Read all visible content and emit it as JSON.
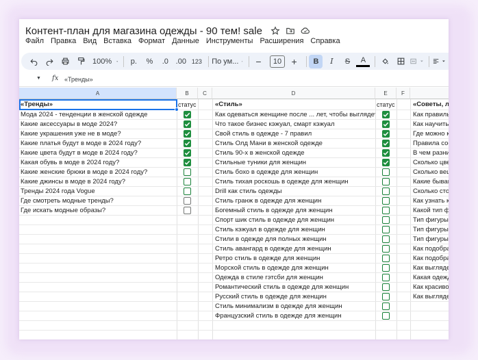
{
  "title": "Контент-план для магазина одежды - 90 тем! sale",
  "title_icons": [
    "star-icon",
    "move-to-folder-icon",
    "cloud-status-icon"
  ],
  "menu": [
    "Файл",
    "Правка",
    "Вид",
    "Вставка",
    "Формат",
    "Данные",
    "Инструменты",
    "Расширения",
    "Справка"
  ],
  "toolbar": {
    "zoom": "100%",
    "currency": "р.",
    "percent": "%",
    "dec_less": ".0",
    "dec_more": ".00",
    "num_format": "123",
    "font": "По ум...",
    "font_size": "10",
    "minus": "−",
    "plus": "+",
    "bold": "B",
    "italic": "I",
    "strike": "S",
    "text_color": "A",
    "icons": [
      "undo-icon",
      "redo-icon",
      "print-icon",
      "paint-format-icon",
      "chevron-down-icon",
      "fill-color-icon",
      "borders-icon",
      "merge-icon",
      "align-icon"
    ]
  },
  "formula_bar": {
    "fx": "fx",
    "value": "«Тренды»"
  },
  "columns": [
    "A",
    "B",
    "C",
    "D",
    "E",
    "F"
  ],
  "sheet": {
    "header": {
      "a": "«Тренды»",
      "b": "статус",
      "d": "«Стиль»",
      "e": "статус",
      "g": "«Советы, л"
    },
    "col_a": [
      "Мода 2024 - тенденции в женской одежде",
      "Какие аксессуары в моде 2024?",
      "Какие украшения уже не в моде?",
      "Какие платья будут в моде в 2024 году?",
      "Какие цвета будут в моде в 2024 году?",
      "Какая обувь в моде в 2024 году?",
      "Какие женские брюки в моде в 2024 году?",
      "Какие джинсы в моде в 2024 году?",
      "Тренды 2024 года Vogue",
      "Где смотреть модные тренды?",
      "Где искать модные образы?"
    ],
    "col_b_status": [
      "done",
      "done",
      "done",
      "done",
      "done",
      "done",
      "todo",
      "todo",
      "todo",
      "todo-grey",
      "todo-grey"
    ],
    "col_d": [
      "Как одеваться женщине после ... лет, чтобы выглядеть",
      "Что такое бизнес кэжуал, смарт кэжуал",
      "Свой стиль в одежде - 7 правил",
      "Стиль Олд Мани в женской одежде",
      "Стиль 90-х в женской одежде",
      "Стильные туники для женщин",
      "Стиль бохо в одежде для женщин",
      "Стиль тихая роскошь в одежде для женщин",
      "Drill как стиль одежды",
      "Стиль гранж в одежде для женщин",
      "Богемный стиль в одежде для женщин",
      "Спорт шик стиль в одежде для женщин",
      "Стиль кэжуал в одежде для женщин",
      "Стили в одежде для полных женщин",
      "Стиль авангард в одежде для женщин",
      "Ретро стиль в одежде для женщин",
      "Морской стиль в одежде для женщин",
      "Одежда в стиле гэтсби для женщин",
      "Романтический стиль в одежде для женщин",
      "Русский стиль в одежде для женщин",
      "Стиль минимализм в одежде для женщин",
      "Французский стиль в одежде для женщин"
    ],
    "col_e_status": [
      "done",
      "done",
      "done",
      "done",
      "done",
      "done",
      "todo",
      "todo",
      "todo",
      "todo",
      "todo",
      "todo",
      "todo",
      "todo",
      "todo",
      "todo",
      "todo",
      "todo",
      "todo",
      "todo",
      "todo",
      "todo"
    ],
    "col_g": [
      "Как правиль",
      "Как научить",
      "Где можно к",
      "Правила сос",
      "В чем разни",
      "Сколько цве",
      "Сколько веш",
      "Какие бываю",
      "Сколько сто",
      "Как узнать к",
      "Какой тип ф",
      "Тип фигуры",
      "Тип фигуры",
      "Тип фигуры",
      "Как подобра",
      "Как подобра",
      "Как выгляде",
      "Какая одежд",
      "Как красиво",
      "Как выгляде"
    ]
  }
}
